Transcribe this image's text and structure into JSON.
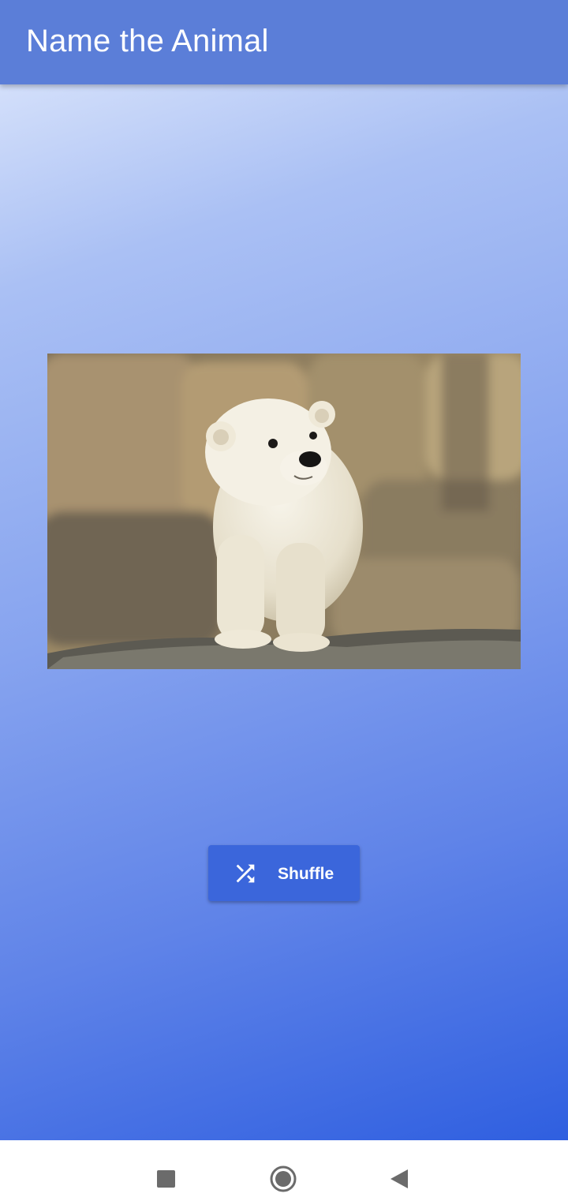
{
  "appbar": {
    "title": "Name the Animal",
    "color": "#5b7ed8"
  },
  "main": {
    "image": {
      "subject": "polar-bear-cub"
    },
    "shuffle_button": {
      "label": "Shuffle",
      "icon": "shuffle-icon",
      "color": "#3b66db"
    }
  },
  "system_nav": {
    "buttons": [
      "recents-icon",
      "home-icon",
      "back-icon"
    ]
  }
}
